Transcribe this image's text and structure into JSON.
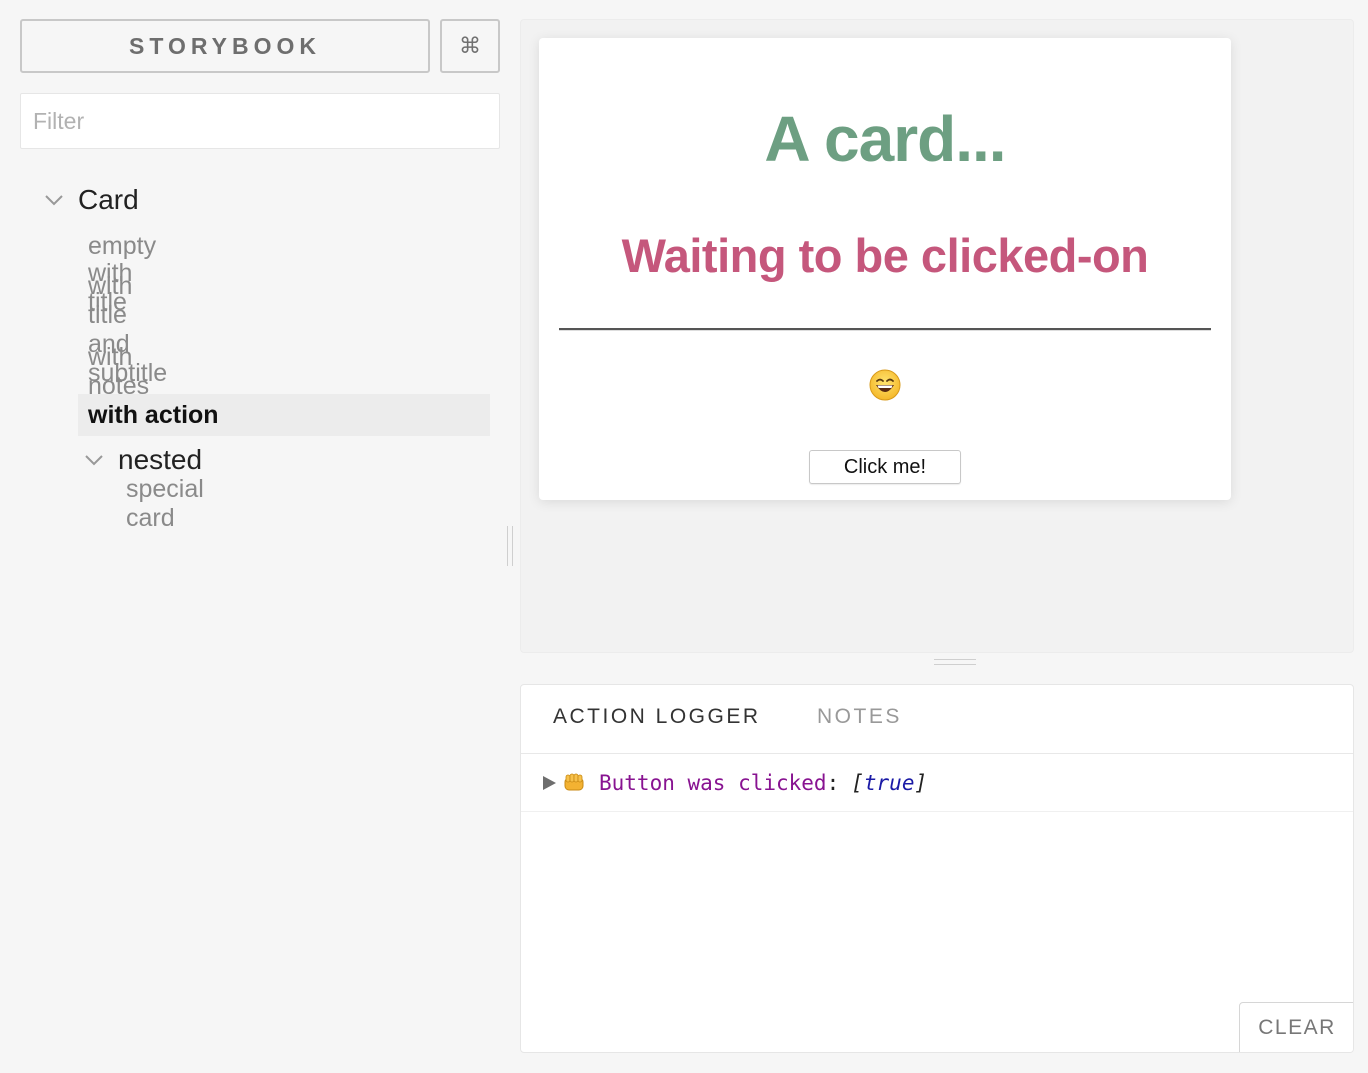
{
  "sidebar": {
    "brand_label": "STORYBOOK",
    "shortcut_label": "⌘",
    "filter_placeholder": "Filter",
    "kind": "Card",
    "stories": [
      "empty",
      "with title",
      "with title and subtitle",
      "with notes",
      "with action"
    ],
    "selected_story": "with action",
    "nested_kind": "nested",
    "nested_stories": [
      "special card"
    ]
  },
  "preview": {
    "card_title": "A card...",
    "card_subtitle": "Waiting to be clicked-on",
    "emoji": "grinning-face",
    "button_label": "Click me!"
  },
  "panel": {
    "tabs": [
      "ACTION LOGGER",
      "NOTES"
    ],
    "active_tab": "ACTION LOGGER",
    "log": [
      {
        "icon": "fist-icon",
        "name": "Button was clicked",
        "colon": ":",
        "value_open": "[",
        "value": "true",
        "value_close": "]"
      }
    ],
    "clear_label": "CLEAR"
  },
  "colors": {
    "title_green": "#6d9f82",
    "subtitle_pink": "#c5577c",
    "log_key": "#881391",
    "log_bool": "#1a1aa6"
  }
}
